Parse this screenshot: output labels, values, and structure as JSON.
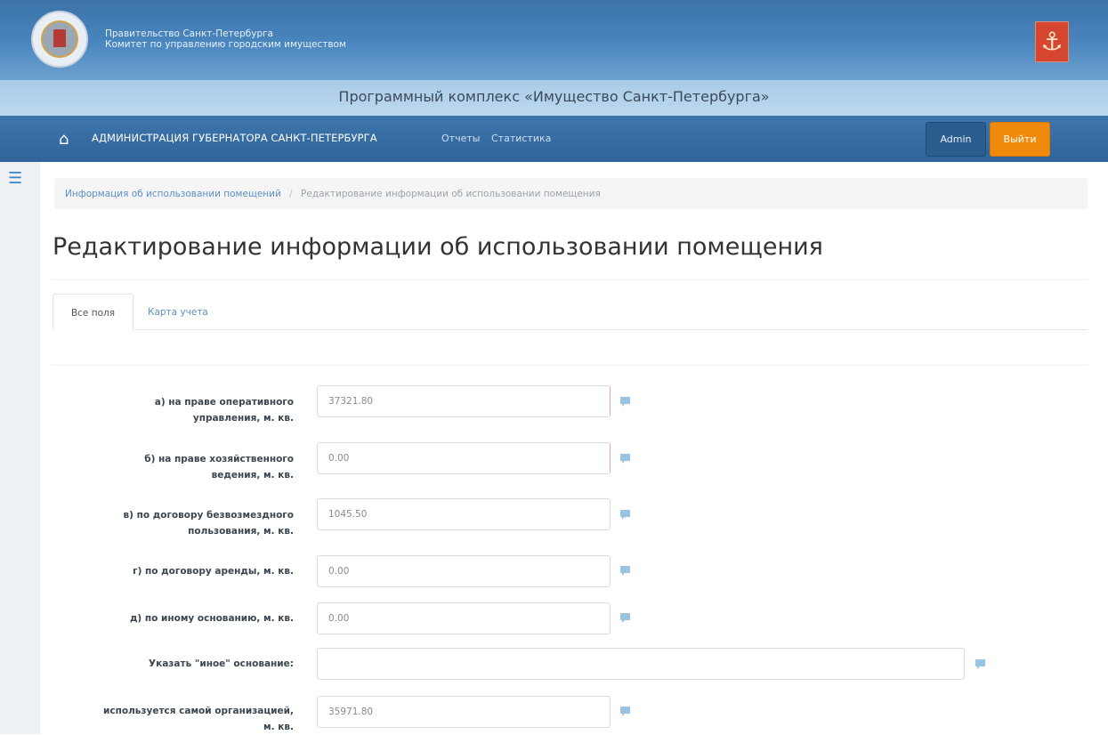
{
  "header": {
    "org_line1": "Правительство Санкт-Петербурга",
    "org_line2": "Комитет по управлению городским имуществом",
    "program_title": "Программный комплекс «Имущество Санкт-Петербурга»"
  },
  "navbar": {
    "brand": "АДМИНИСТРАЦИЯ ГУБЕРНАТОРА САНКТ-ПЕТЕРБУРГА",
    "links": [
      "Отчеты",
      "Статистика"
    ],
    "user_label": "Admin",
    "logout_label": "Выйти"
  },
  "breadcrumb": {
    "link": "Информация об использовании помещений",
    "separator": "/",
    "current": "Редактирование информации об использовании помещения"
  },
  "page": {
    "title": "Редактирование информации об использовании помещения"
  },
  "tabs": [
    {
      "label": "Все поля",
      "active": true
    },
    {
      "label": "Карта учета",
      "active": false
    }
  ],
  "form": {
    "fields": [
      {
        "label_line1": "а) на праве оперативного",
        "label_line2": "управления, м. кв.",
        "value": "37321.80"
      },
      {
        "label_line1": "б) на праве хозяйственного",
        "label_line2": "ведения, м. кв.",
        "value": "0.00"
      },
      {
        "label_line1": "в) по договору безвозмездного",
        "label_line2": "пользования, м. кв.",
        "value": "1045.50"
      },
      {
        "label_line1": "г) по договору аренды, м. кв.",
        "label_line2": "",
        "value": "0.00"
      },
      {
        "label_line1": "д) по иному основанию, м. кв.",
        "label_line2": "",
        "value": "0.00"
      },
      {
        "label_line1": "Указать \"иное\" основание:",
        "label_line2": "",
        "value": ""
      },
      {
        "label_line1": "используется самой организацией,",
        "label_line2": "м. кв.",
        "value": "35971.80"
      }
    ]
  },
  "colors": {
    "header_blue": "#4a86bf",
    "navbar_blue": "#2f6399",
    "logout_orange": "#f08a0c",
    "link_blue": "#5b8fc5",
    "comment_icon": "#9bc3e2"
  },
  "icons": [
    "coat-of-arms",
    "flag",
    "home-icon",
    "list-icon",
    "comment-icon"
  ]
}
